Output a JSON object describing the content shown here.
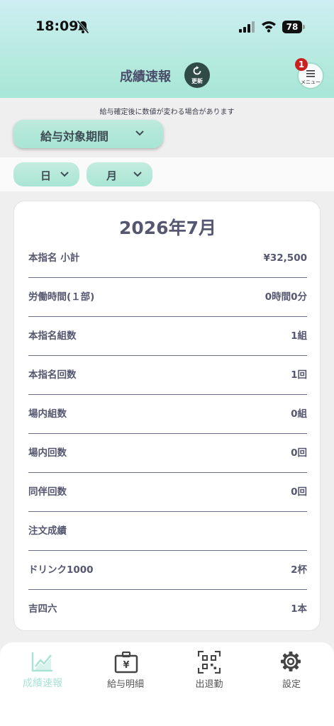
{
  "status_bar": {
    "time": "18:09",
    "battery": "78"
  },
  "header": {
    "title": "成績速報",
    "refresh_label": "更新",
    "menu_label": "メニュー",
    "menu_badge": "1"
  },
  "notice": "給与確定後に数値が変わる場合があります",
  "period_selector": {
    "label": "給与対象期間"
  },
  "filters": {
    "day_label": "日",
    "month_label": "月"
  },
  "card": {
    "title": "2026年7月",
    "rows": [
      {
        "label": "本指名 小計",
        "value": "¥32,500"
      },
      {
        "label": "労働時間(１部)",
        "value": "0時間0分"
      },
      {
        "label": "本指名組数",
        "value": "1組"
      },
      {
        "label": "本指名回数",
        "value": "1回"
      },
      {
        "label": "場内組数",
        "value": "0組"
      },
      {
        "label": "場内回数",
        "value": "0回"
      },
      {
        "label": "同伴回数",
        "value": "0回"
      },
      {
        "label": "注文成績",
        "value": ""
      },
      {
        "label": "ドリンク1000",
        "value": "2杯"
      },
      {
        "label": "吉四六",
        "value": "1本"
      }
    ]
  },
  "tabbar": {
    "items": [
      {
        "label": "成績速報",
        "icon": "chart-icon",
        "active": true
      },
      {
        "label": "給与明細",
        "icon": "yen-bag-icon",
        "active": false
      },
      {
        "label": "出退勤",
        "icon": "qr-code-icon",
        "active": false
      },
      {
        "label": "設定",
        "icon": "gear-icon",
        "active": false
      }
    ]
  },
  "colors": {
    "accent": "#a9e5d4",
    "text": "#555770",
    "badge": "#c9211f",
    "refresh_bg": "#2f4a47"
  }
}
